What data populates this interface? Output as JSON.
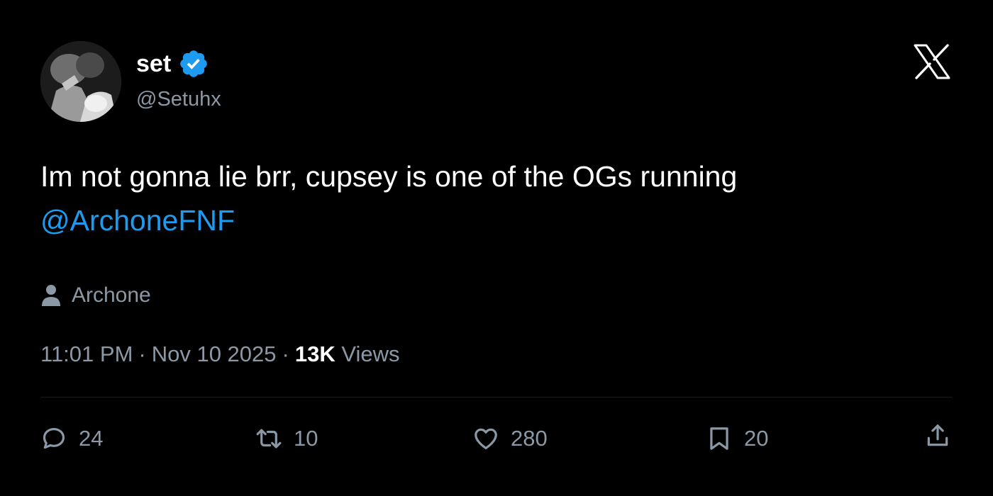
{
  "author": {
    "display_name": "set",
    "handle": "@Setuhx",
    "verified": true,
    "avatar_icon": "avatar-photo"
  },
  "brand": {
    "logo_icon": "x-logo-icon"
  },
  "tweet": {
    "text": "Im not gonna lie brr, cupsey is one of the OGs running",
    "mention": "@ArchoneFNF"
  },
  "tagged": {
    "icon": "person-icon",
    "name": "Archone"
  },
  "meta": {
    "time": "11:01 PM",
    "separator": "·",
    "date": "Nov 10 2025",
    "views_count": "13K",
    "views_label": "Views"
  },
  "actions": {
    "reply": {
      "icon": "reply-icon",
      "count": "24"
    },
    "repost": {
      "icon": "repost-icon",
      "count": "10"
    },
    "like": {
      "icon": "heart-icon",
      "count": "280"
    },
    "bookmark": {
      "icon": "bookmark-icon",
      "count": "20"
    },
    "share": {
      "icon": "share-icon"
    }
  },
  "colors": {
    "background": "#000000",
    "primary_text": "#ffffff",
    "secondary_text": "#8b98a5",
    "accent": "#1d9bf0"
  }
}
